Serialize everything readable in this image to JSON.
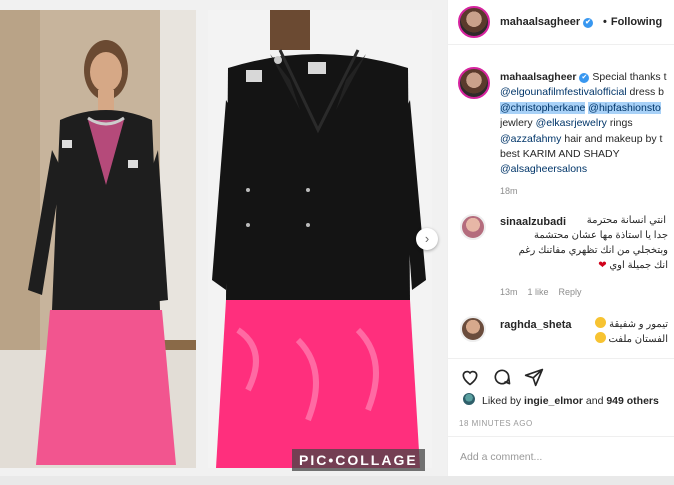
{
  "post": {
    "watermark": "PIC•COLLAGE",
    "next_arrow": "›"
  },
  "header": {
    "username": "mahaalsagheer",
    "verified_mark": "✔",
    "separator": "•",
    "follow_label": "Following"
  },
  "caption": {
    "username": "mahaalsagheer",
    "text_1": "Special thanks t",
    "mention_1": "@elgounafilmfestivalofficial",
    "text_2": " dress b",
    "mention_2": "@christopherkane",
    "mention_3": "@hipfashionsto",
    "text_3": "jewlery ",
    "mention_4": "@elkasrjewelry",
    "text_4": " rings",
    "mention_5": "@azzafahmy",
    "text_5": " hair and makeup by t",
    "text_6": "best KARIM AND SHADY",
    "mention_6": "@alsagheersalons",
    "time": "18m"
  },
  "comments": [
    {
      "username": "sinaalzubadi",
      "line_1": "انتي انسانة محترمة",
      "line_2": "جدا يا استاذة مها عشان محتشمة",
      "line_3": "وبتخجلي من انك تظهري مفاتنك رغم",
      "line_4": "انك جميلة اوي",
      "time": "13m",
      "likes": "1 like",
      "reply": "Reply"
    },
    {
      "username": "raghda_sheta",
      "line_1": "تيمور و شفيقة",
      "line_2": "الفستان ملفت"
    }
  ],
  "actions": {
    "liked_by_prefix": "Liked by ",
    "liked_by_user": "ingie_elmor",
    "liked_by_and": " and ",
    "others": "949 others",
    "posted_time": "18 MINUTES AGO",
    "add_comment_placeholder": "Add a comment..."
  },
  "icons": [
    "heart-icon",
    "comment-icon",
    "share-icon",
    "verified-icon",
    "chevron-right-icon"
  ]
}
